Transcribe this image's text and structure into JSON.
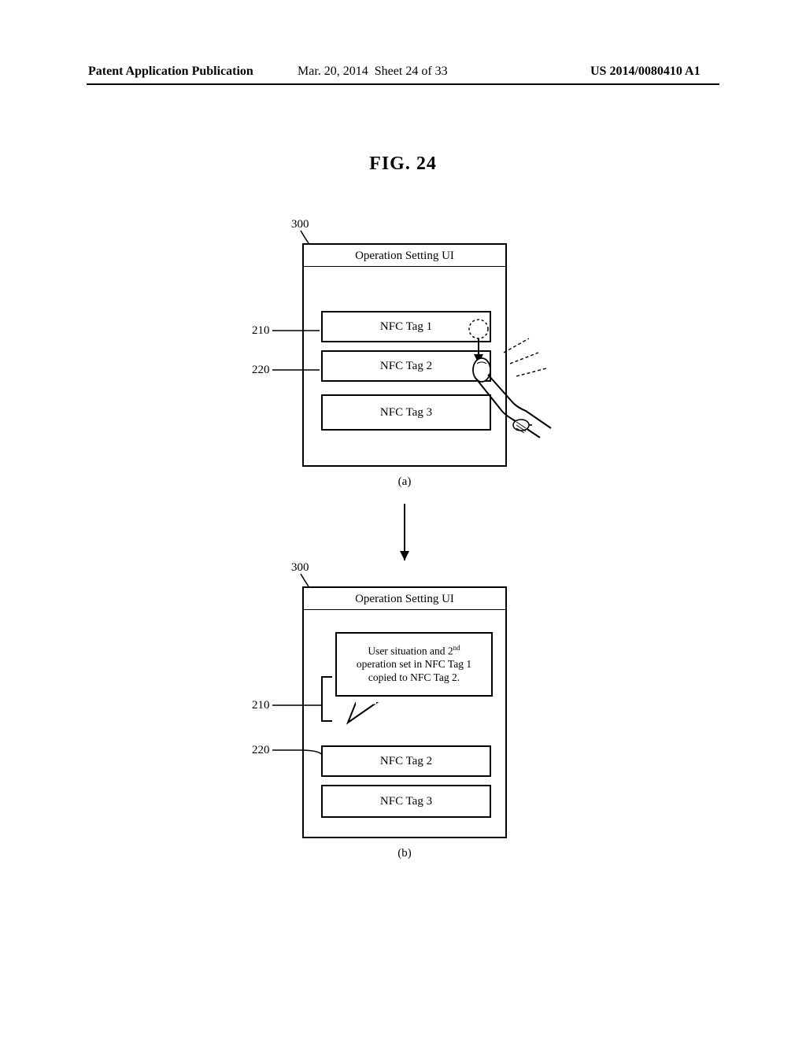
{
  "header": {
    "left": "Patent Application Publication",
    "mid_date": "Mar. 20, 2014",
    "mid_sheet": "Sheet 24 of 33",
    "right": "US 2014/0080410 A1"
  },
  "figure_title": "FIG. 24",
  "refs": {
    "r300": "300",
    "r210": "210",
    "r220": "220"
  },
  "panel_a": {
    "title": "Operation Setting UI",
    "tags": {
      "t1": "NFC Tag 1",
      "t2": "NFC Tag 2",
      "t3": "NFC Tag 3"
    },
    "sublabel": "(a)"
  },
  "panel_b": {
    "title": "Operation Setting UI",
    "popup_line1": "User situation and 2",
    "popup_ord": "nd",
    "popup_line2": "operation set in NFC Tag 1",
    "popup_line3": "copied to NFC Tag 2.",
    "tags": {
      "t2": "NFC Tag 2",
      "t3": "NFC Tag 3"
    },
    "sublabel": "(b)"
  }
}
